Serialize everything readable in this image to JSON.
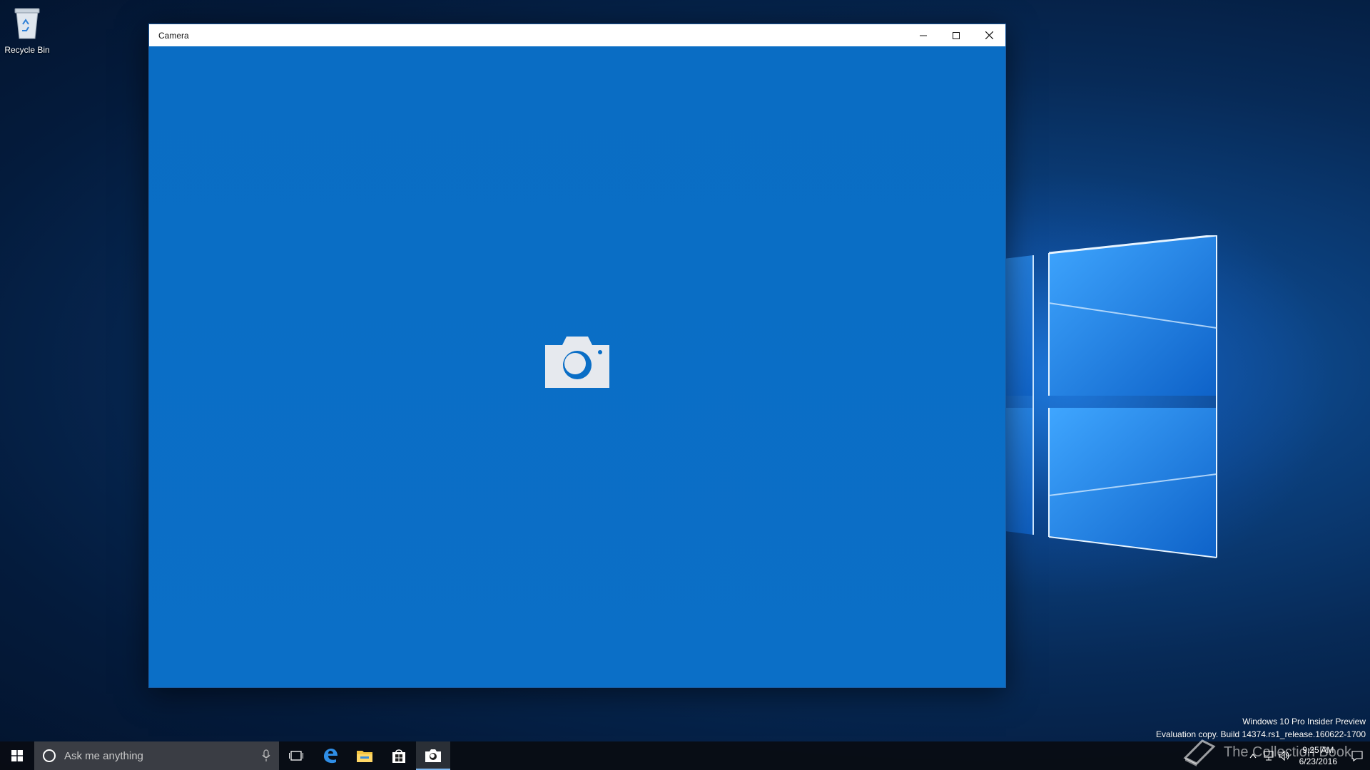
{
  "desktop": {
    "recycle_bin_label": "Recycle Bin"
  },
  "window": {
    "title": "Camera",
    "controls": [
      "minimize-icon",
      "maximize-icon",
      "close-icon"
    ],
    "content_icon": "camera-icon",
    "accent_color": "#0a6ec6"
  },
  "watermark": {
    "line1": "Windows 10 Pro Insider Preview",
    "line2": "Evaluation copy. Build 14374.rs1_release.160622-1700"
  },
  "taskbar": {
    "search_placeholder": "Ask me anything",
    "pinned": [
      "task-view-icon",
      "edge-icon",
      "file-explorer-icon",
      "store-icon",
      "camera-icon"
    ],
    "active_app": "Camera",
    "clock_time": "9:25 AM",
    "clock_date": "6/23/2016",
    "brand_overlay": "The Collection Book"
  }
}
